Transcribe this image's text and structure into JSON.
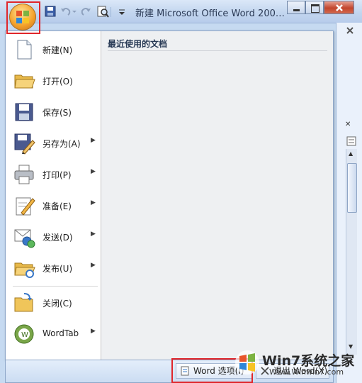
{
  "window": {
    "title": "新建 Microsoft Office Word 200…"
  },
  "menu": {
    "items": [
      {
        "label": "新建(N)",
        "icon": "new-document-icon",
        "has_submenu": false
      },
      {
        "label": "打开(O)",
        "icon": "open-folder-icon",
        "has_submenu": false
      },
      {
        "label": "保存(S)",
        "icon": "save-disk-icon",
        "has_submenu": false
      },
      {
        "label": "另存为(A)",
        "icon": "save-as-icon",
        "has_submenu": true
      },
      {
        "label": "打印(P)",
        "icon": "printer-icon",
        "has_submenu": true
      },
      {
        "label": "准备(E)",
        "icon": "prepare-icon",
        "has_submenu": true
      },
      {
        "label": "发送(D)",
        "icon": "send-icon",
        "has_submenu": true
      },
      {
        "label": "发布(U)",
        "icon": "publish-icon",
        "has_submenu": true
      },
      {
        "label": "关闭(C)",
        "icon": "close-folder-icon",
        "has_submenu": false
      },
      {
        "label": "WordTab",
        "icon": "wordtab-icon",
        "has_submenu": true
      }
    ],
    "recent_title": "最近使用的文档"
  },
  "bottom": {
    "options_label": "Word 选项(I)",
    "exit_label": "退出 Word(X)"
  },
  "watermark": {
    "text": "Win7系统之家",
    "url": "Www.Winwin7.com"
  },
  "colors": {
    "highlight": "#e0262b",
    "titlebar": "#c3d6ef",
    "menu_background": "#ffffff",
    "recent_background": "#eef0f2"
  }
}
